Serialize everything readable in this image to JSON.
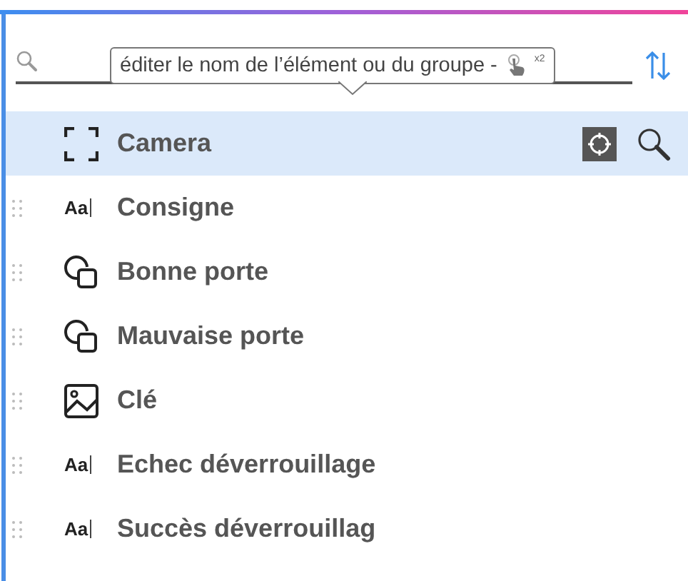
{
  "tooltip": {
    "text": "éditer le nom de l’élément ou du groupe -",
    "badge": "x2"
  },
  "items": [
    {
      "kind": "frame",
      "label": "Camera",
      "selected": true
    },
    {
      "kind": "text",
      "glyph": "Aa",
      "label": "Consigne",
      "selected": false
    },
    {
      "kind": "shape",
      "label": "Bonne porte",
      "selected": false
    },
    {
      "kind": "shape",
      "label": "Mauvaise porte",
      "selected": false
    },
    {
      "kind": "image",
      "label": "Clé",
      "selected": false
    },
    {
      "kind": "text",
      "glyph": "Aa",
      "label": "Echec déverrouillage",
      "selected": false
    },
    {
      "kind": "text",
      "glyph": "Aa",
      "label": "Succès déverrouillag",
      "selected": false
    }
  ]
}
